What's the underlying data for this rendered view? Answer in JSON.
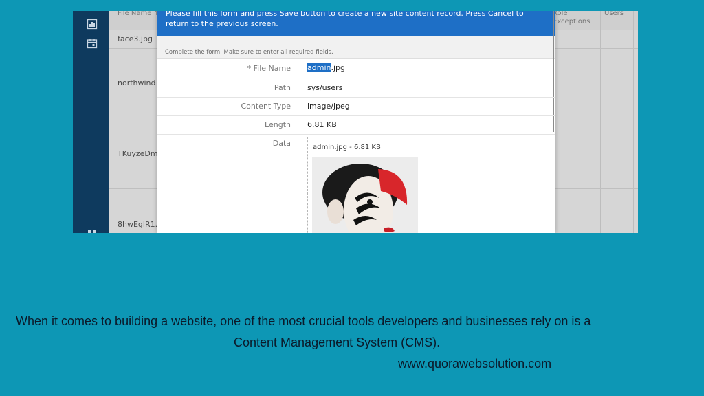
{
  "grid": {
    "columns": {
      "file_name": "File Name ↑",
      "role_exceptions": "Role\nExceptions",
      "users": "Users"
    },
    "rows": [
      "face3.jpg",
      "northwind",
      "TKuyzeDm...",
      "8hwEglR1..."
    ]
  },
  "modal": {
    "banner": "Please fill this form and press Save button to create a new site content record. Press Cancel to return to the previous screen.",
    "instruction": "Complete the form. Make sure to enter all required fields.",
    "fields": {
      "file_name": {
        "label": "* File Name",
        "selected": "admin",
        "rest": ".jpg"
      },
      "path": {
        "label": "Path",
        "value": "sys/users"
      },
      "content_type": {
        "label": "Content Type",
        "value": "image/jpeg"
      },
      "length": {
        "label": "Length",
        "value": "6.81 KB"
      },
      "data": {
        "label": "Data",
        "caption": "admin.jpg - 6.81 KB"
      }
    }
  },
  "caption": {
    "line1": "When it comes to building a website, one of the most crucial tools developers and businesses rely on is a",
    "line2": "Content Management System (CMS).",
    "url": "www.quorawebsolution.com"
  },
  "icons": [
    "chart-icon",
    "calendar-icon",
    "grid-icon"
  ],
  "colors": {
    "background": "#0d97b5",
    "nav": "#0e3a5e",
    "accent": "#1e6fc6"
  }
}
